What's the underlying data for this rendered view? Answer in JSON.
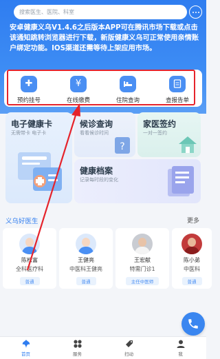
{
  "search": {
    "placeholder": "搜索医生、医院、科室"
  },
  "notice": "安卓健康义乌V1.4.6之后版本APP可在腾讯市场下载或点击该通知跳转浏览器进行下载，新版健康义乌可正常使用亲情账户绑定功能。IOS渠道还需等待上架应用市场。",
  "quick_services": [
    {
      "label": "预约挂号",
      "icon": "plus-icon",
      "glyph": "+"
    },
    {
      "label": "在线缴费",
      "icon": "yen-icon",
      "glyph": "¥"
    },
    {
      "label": "住院查询",
      "icon": "bed-icon",
      "glyph": "⌂"
    },
    {
      "label": "查报告单",
      "icon": "report-icon",
      "glyph": "≡"
    }
  ],
  "features": {
    "health_card": {
      "title": "电子健康卡",
      "subtitle": "无需带卡 电子卡"
    },
    "visit": {
      "title": "候诊查询",
      "subtitle": "看看候诊时间"
    },
    "family": {
      "title": "家医签约",
      "subtitle": "一对一签约"
    },
    "record": {
      "title": "健康档案",
      "subtitle": "记录每时段的变化"
    }
  },
  "doctors_section": {
    "title": "义乌好医生",
    "more": "更多"
  },
  "doctors": [
    {
      "name": "陈松富",
      "title": "全科医疗科",
      "tag": "普通"
    },
    {
      "name": "王健亮",
      "title": "中医科王健亮",
      "tag": "普通"
    },
    {
      "name": "王宏献",
      "title": "特需门诊1",
      "tag": "主任中医师"
    },
    {
      "name": "陈小弟",
      "title": "中医科",
      "tag": "普通"
    }
  ],
  "nav": [
    {
      "label": "首页",
      "icon": "home-icon",
      "active": true
    },
    {
      "label": "服务",
      "icon": "grid-icon",
      "active": false
    },
    {
      "label": "扫动",
      "icon": "tag-icon",
      "active": false
    },
    {
      "label": "我",
      "icon": "user-icon",
      "active": false
    }
  ],
  "colors": {
    "brand": "#2f7df0",
    "highlight": "#e5232b"
  }
}
